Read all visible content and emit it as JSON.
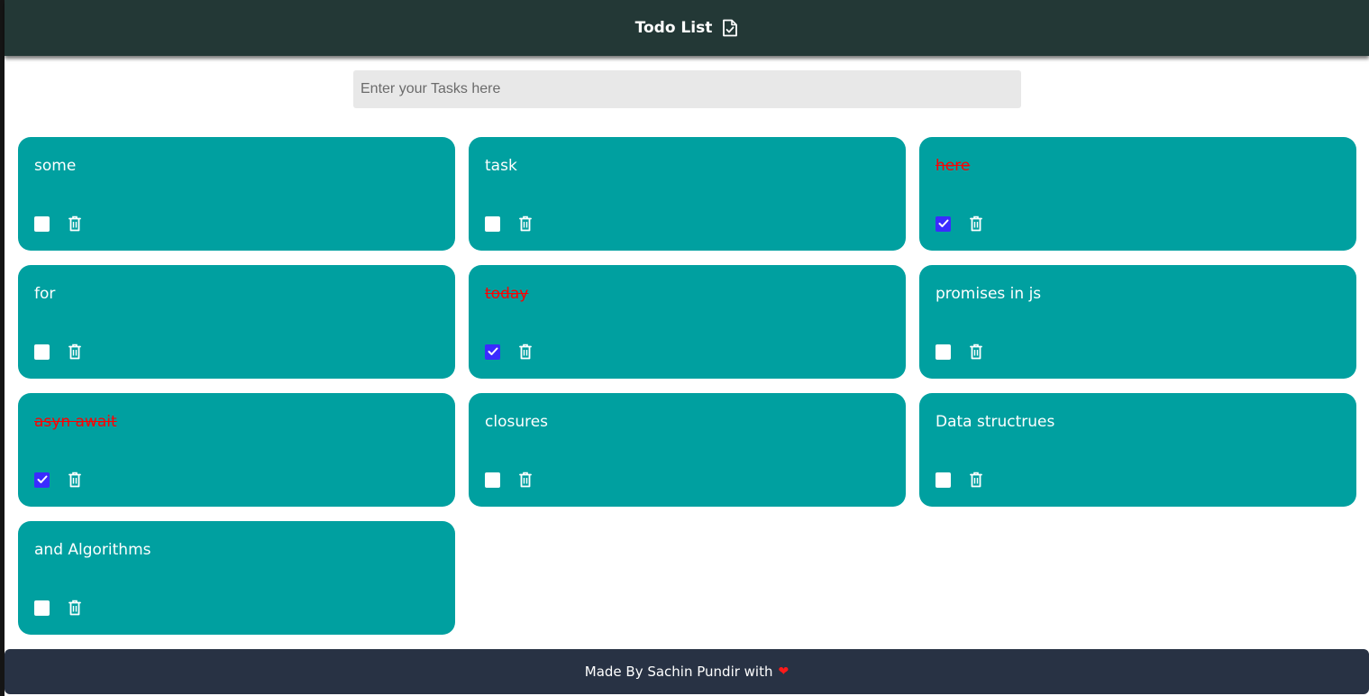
{
  "header": {
    "title": "Todo List",
    "icon": "file-check-icon"
  },
  "input": {
    "placeholder": "Enter your Tasks here",
    "value": ""
  },
  "tasks": [
    {
      "text": "some",
      "done": false
    },
    {
      "text": "task",
      "done": false
    },
    {
      "text": "here",
      "done": true
    },
    {
      "text": "for",
      "done": false
    },
    {
      "text": "today",
      "done": true
    },
    {
      "text": "promises in js",
      "done": false
    },
    {
      "text": "asyn await",
      "done": true
    },
    {
      "text": "closures",
      "done": false
    },
    {
      "text": "Data structrues",
      "done": false
    },
    {
      "text": "and Algorithms",
      "done": false
    }
  ],
  "footer": {
    "text": "Made By Sachin Pundir with",
    "heart": "❤"
  },
  "colors": {
    "header_bg": "#233836",
    "card_bg": "#00a0a0",
    "done_text": "#ff0000",
    "checkbox_checked": "#3b2bff",
    "footer_bg": "#283244"
  }
}
